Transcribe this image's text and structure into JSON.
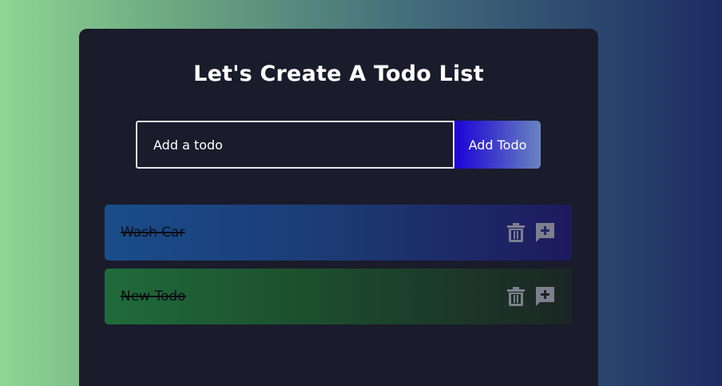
{
  "app": {
    "title": "Let's Create A Todo List"
  },
  "form": {
    "input_value": "",
    "input_placeholder": "Add a todo",
    "add_label": "Add Todo"
  },
  "todos": [
    {
      "text": "Wash Car",
      "completed": true,
      "color": "#1a4d8a"
    },
    {
      "text": "New Todo",
      "completed": true,
      "color": "#1f6b3a"
    }
  ],
  "icons": {
    "delete": "trash-icon",
    "edit": "add-comment-icon"
  },
  "colors": {
    "panel": "#1a1b2b",
    "icon": "#7d7f8e",
    "button_gradient_start": "#1b03d6",
    "button_gradient_end": "#6a84c0"
  }
}
